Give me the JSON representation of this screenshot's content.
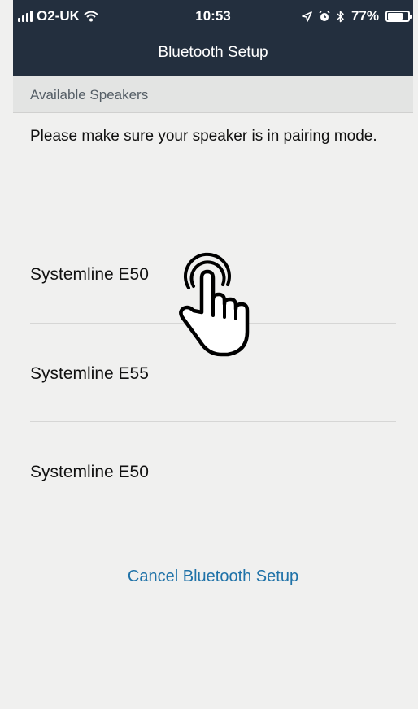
{
  "status_bar": {
    "carrier": "O2-UK",
    "time": "10:53",
    "battery_text": "77%",
    "battery_level": 0.77
  },
  "header": {
    "title": "Bluetooth Setup"
  },
  "section": {
    "title": "Available Speakers"
  },
  "instruction": "Please make sure your speaker is in pairing mode.",
  "speakers": [
    {
      "label": "Systemline E50"
    },
    {
      "label": "Systemline E55"
    },
    {
      "label": "Systemline E50"
    }
  ],
  "cancel_label": "Cancel Bluetooth Setup",
  "colors": {
    "header_bg": "#232f3e",
    "page_bg": "#f0f0ef",
    "section_bg": "#e3e4e3",
    "link": "#1f72a8"
  },
  "icons": [
    "signal-icon",
    "wifi-icon",
    "location-icon",
    "alarm-icon",
    "bluetooth-icon",
    "battery-icon",
    "hand-tap-icon"
  ]
}
